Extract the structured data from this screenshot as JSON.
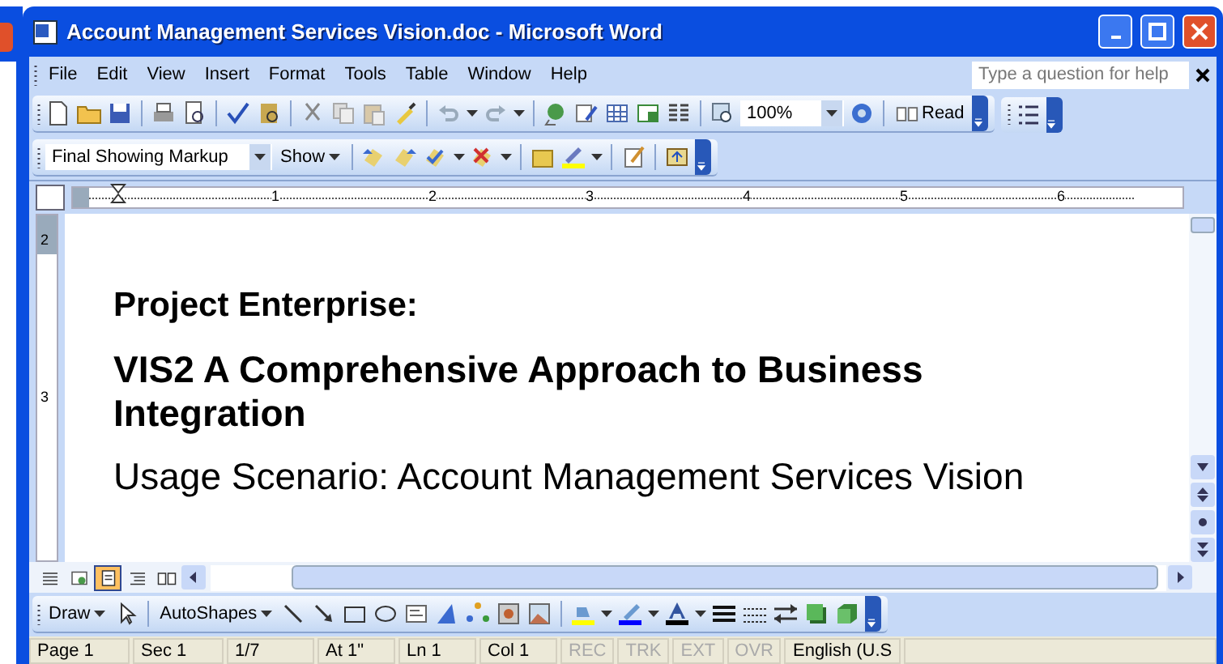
{
  "window": {
    "title": "Account Management Services Vision.doc - Microsoft Word"
  },
  "menu": [
    {
      "label": "File"
    },
    {
      "label": "Edit"
    },
    {
      "label": "View"
    },
    {
      "label": "Insert"
    },
    {
      "label": "Format"
    },
    {
      "label": "Tools"
    },
    {
      "label": "Table"
    },
    {
      "label": "Window"
    },
    {
      "label": "Help"
    }
  ],
  "help_box": {
    "placeholder": "Type a question for help"
  },
  "standard_toolbar": {
    "zoom": "100%",
    "read_button": "Read"
  },
  "reviewing_toolbar": {
    "display_for_review": "Final Showing Markup",
    "show_button": "Show"
  },
  "ruler": {
    "marks": [
      "1",
      "2",
      "3",
      "4",
      "5",
      "6"
    ]
  },
  "vertical_ruler": {
    "marks": [
      "2",
      "3"
    ]
  },
  "document": [
    {
      "kind": "heading",
      "text": "Project Enterprise:"
    },
    {
      "kind": "title",
      "text": "VIS2 A Comprehensive Approach to Business Integration"
    },
    {
      "kind": "subtitle",
      "text": "Usage Scenario: Account Management Services Vision"
    }
  ],
  "view_buttons": [
    {
      "selected": false
    },
    {
      "selected": false
    },
    {
      "selected": true
    },
    {
      "selected": false
    },
    {
      "selected": false
    }
  ],
  "drawing_toolbar": {
    "draw_button": "Draw",
    "autoshapes_button": "AutoShapes"
  },
  "status_bar": {
    "fields": [
      "Page 1",
      "Sec 1",
      "1/7",
      "At 1\"",
      "Ln 1",
      "Col 1"
    ],
    "indicators": [
      {
        "label": "REC",
        "disabled": true
      },
      {
        "label": "TRK",
        "disabled": true
      },
      {
        "label": "EXT",
        "disabled": true
      },
      {
        "label": "OVR",
        "disabled": true
      }
    ],
    "language": "English (U.S"
  }
}
